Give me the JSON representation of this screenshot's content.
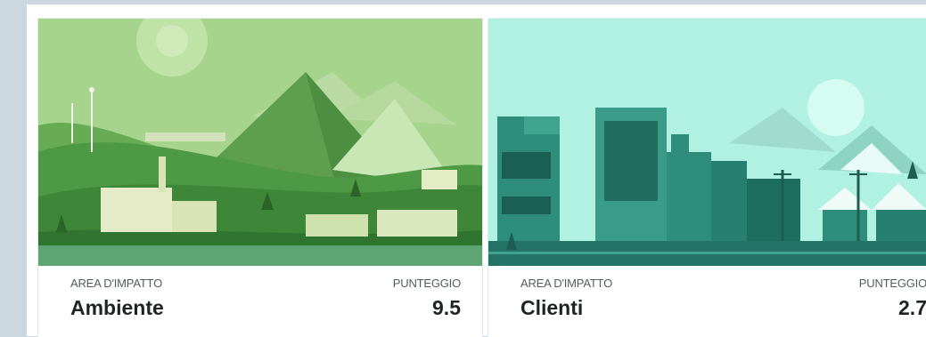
{
  "cards": [
    {
      "label_left": "AREA D'IMPATTO",
      "label_right": "PUNTEGGIO",
      "title": "Ambiente",
      "score": "9.5",
      "illustration": "environment-landscape-illustration",
      "colors": {
        "sky": "#a9d58f",
        "accent": "#3f8b46"
      }
    },
    {
      "label_left": "AREA D'IMPATTO",
      "label_right": "PUNTEGGIO",
      "title": "Clienti",
      "score": "2.7",
      "illustration": "city-customers-illustration",
      "colors": {
        "sky": "#b2f2e4",
        "accent": "#2a8f7c"
      }
    }
  ]
}
